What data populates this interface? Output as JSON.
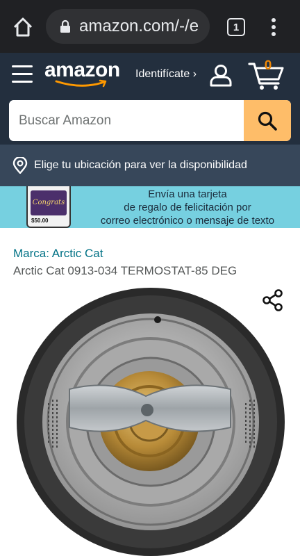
{
  "browser": {
    "url": "amazon.com/-/e",
    "tab_count": "1"
  },
  "header": {
    "logo_text": "amazon",
    "signin_label": "Identifícate ›",
    "cart_count": "0"
  },
  "search": {
    "placeholder": "Buscar Amazon"
  },
  "location": {
    "text": "Elige tu ubicación para ver la disponibilidad"
  },
  "banner": {
    "line1": "Envía una tarjeta",
    "line2": "de regalo de felicitación por",
    "line3": "correo electrónico o mensaje de texto",
    "card_text": "Congrats",
    "card_price": "$50.00"
  },
  "product": {
    "brand": "Marca: Arctic Cat",
    "title": "Arctic Cat 0913-034 TERMOSTAT-85 DEG"
  },
  "colors": {
    "header_bg": "#232f3e",
    "location_bg": "#37475a",
    "search_button": "#febd69",
    "cart_count": "#f08804",
    "link": "#007185",
    "banner_bg": "#76d0e0"
  }
}
